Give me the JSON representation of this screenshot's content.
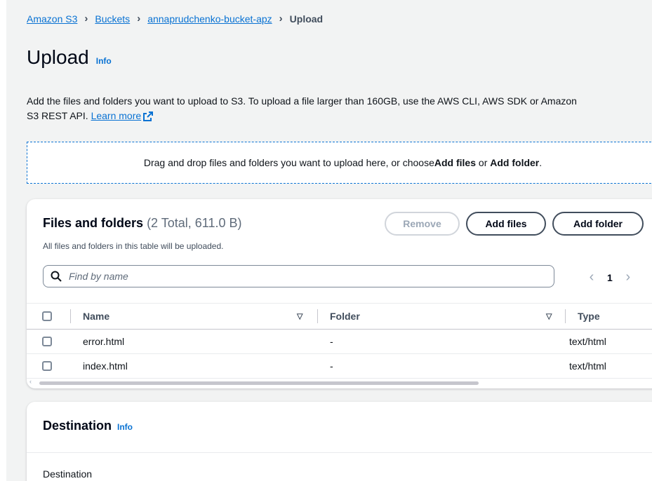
{
  "breadcrumb": {
    "items": [
      "Amazon S3",
      "Buckets",
      "annaprudchenko-bucket-apz"
    ],
    "current": "Upload"
  },
  "header": {
    "title": "Upload",
    "info": "Info"
  },
  "description": {
    "line1": "Add the files and folders you want to upload to S3. To upload a file larger than 160GB, use the AWS CLI, AWS SDK or Amazon",
    "line2": "S3 REST API.",
    "learn_more": "Learn more"
  },
  "dropzone": {
    "text_before": "Drag and drop files and folders you want to upload here, or choose ",
    "add_files": "Add files",
    "or": " or ",
    "add_folder": "Add folder",
    "end": "."
  },
  "files_panel": {
    "title": "Files and folders",
    "counter": "(2 Total, 611.0 B)",
    "subtitle": "All files and folders in this table will be uploaded.",
    "buttons": {
      "remove": "Remove",
      "add_files": "Add files",
      "add_folder": "Add folder"
    },
    "search": {
      "placeholder": "Find by name"
    },
    "pagination": {
      "current_page": "1",
      "prev": "‹",
      "next": "›"
    },
    "columns": {
      "name": "Name",
      "folder": "Folder",
      "type": "Type"
    },
    "rows": [
      {
        "name": "error.html",
        "folder": "-",
        "type": "text/html"
      },
      {
        "name": "index.html",
        "folder": "-",
        "type": "text/html"
      }
    ]
  },
  "destination_panel": {
    "title": "Destination",
    "info": "Info",
    "label": "Destination"
  },
  "colors": {
    "link": "#0972d3",
    "page_bg": "#f2f3f3",
    "panel_bg": "#ffffff",
    "text": "#0f141a",
    "disabled": "#9ba7b6"
  },
  "icons": {
    "breadcrumb_separator": "chevron-right-icon",
    "external_link": "external-link-icon",
    "search": "search-icon",
    "sort": "caret-down-icon",
    "pager_prev": "chevron-left-icon",
    "pager_next": "chevron-right-icon"
  }
}
